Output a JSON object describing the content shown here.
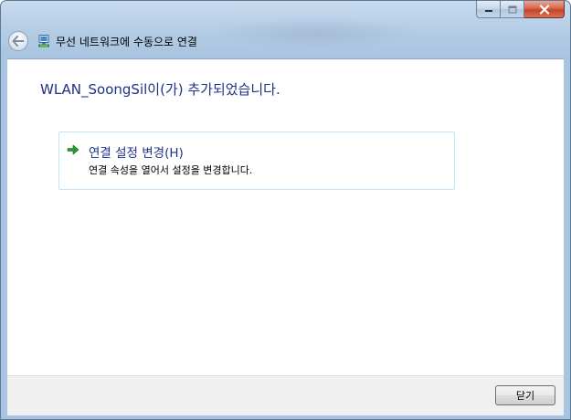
{
  "window": {
    "title": "무선 네트워크에 수동으로 연결"
  },
  "main": {
    "heading": "WLAN_SoongSil이(가) 추가되었습니다.",
    "option": {
      "title": "연결 설정 변경(H)",
      "description": "연결 속성을 열어서 설정을 변경합니다.",
      "icon": "green-arrow-icon"
    }
  },
  "footer": {
    "close_label": "닫기"
  },
  "colors": {
    "heading_text": "#1e3287",
    "arrow": "#2e9a2e",
    "close_caption": "#c44424",
    "frame": "#a9c4e1"
  }
}
